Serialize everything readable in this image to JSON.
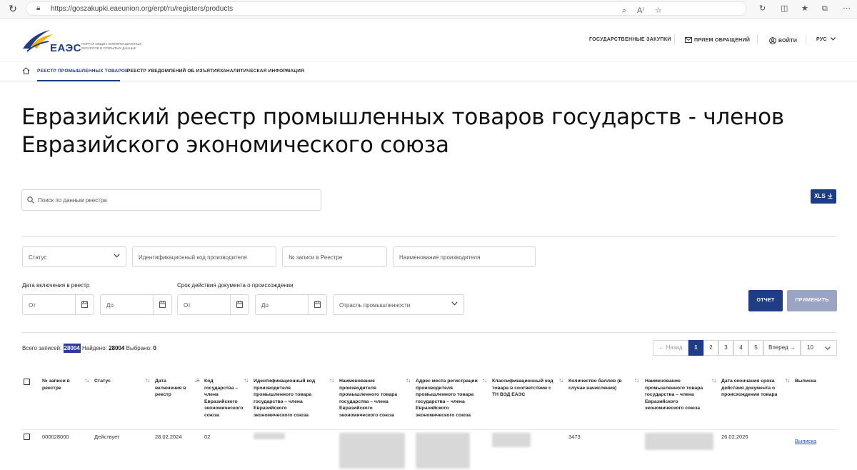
{
  "browser": {
    "url": "https://goszakupki.eaeunion.org/erpt/ru/registers/products"
  },
  "header": {
    "brand": "ЕАЭС",
    "tagline": "ПОРТАЛ ОБЩИХ ИНФОРМАЦИОННЫХ РЕСУРСОВ И ОТКРЫТЫХ ДАННЫХ",
    "nav_procurement": "ГОСУДАРСТВЕННЫЕ ЗАКУПКИ",
    "nav_appeals": "ПРИЕМ ОБРАЩЕНИЙ",
    "nav_login": "ВОЙТИ",
    "nav_lang": "РУС"
  },
  "subnav": {
    "tabs": [
      {
        "label": "РЕЕСТР ПРОМЫШЛЕННЫХ ТОВАРОВ"
      },
      {
        "label": "РЕЕСТР УВЕДОМЛЕНИЙ ОБ ИЗЪЯТИЯХ"
      },
      {
        "label": "АНАЛИТИЧЕСКАЯ ИНФОРМАЦИЯ"
      }
    ]
  },
  "page": {
    "title": "Евразийский реестр промышленных товаров государств - членов Евразийского экономического союза"
  },
  "search": {
    "placeholder": "Поиск по данным реестра",
    "xls_label": "XLS"
  },
  "filters": {
    "status": "Статус",
    "manufacturer_id": "Идентификационный код производителя",
    "record_no": "№ записи в Реестре",
    "manufacturer_name": "Наименование производителя",
    "date_included_label": "Дата включения в реестр",
    "doc_validity_label": "Срок действия документа о происхождении",
    "from": "От",
    "to": "До",
    "industry": "Отрасль промышленности",
    "report_button": "ОТЧЕТ",
    "apply_button": "ПРИМЕНИТЬ"
  },
  "summary": {
    "total_label": "Всего записей:",
    "total_value": "28004",
    "found_label": "Найдено:",
    "found_value": "28004",
    "selected_label": "Выбрано:",
    "selected_value": "0"
  },
  "pagination": {
    "prev": "Назад",
    "pages": [
      "1",
      "2",
      "3",
      "4",
      "5"
    ],
    "next": "Вперед",
    "page_size": "10"
  },
  "table": {
    "headers": [
      "№ записи в реестре",
      "Статус",
      "Дата включения в реестр",
      "Код государства – члена Евразийского экономического союза",
      "Идентификационный код производителя промышленного товара государства – члена Евразийского экономического союза",
      "Наименование производителя промышленного товара государства – члена Евразийского экономического союза",
      "Адрес места регистрации производителя промышленного товара государства – члена Евразийского экономического союза",
      "Классификационный код товара в соответствии с ТН ВЭД ЕАЭС",
      "Количество баллов (в случае начисления)",
      "Наименование промышленного товара государства – члена Евразийского экономического союза",
      "Дата окончания срока действия документа о происхождении товара",
      "Выписка"
    ],
    "rows": [
      {
        "record_no": "000028000",
        "status": "Действует",
        "date": "28.02.2024",
        "state_code": "02",
        "points": "3473",
        "end_date": "26.02.2026",
        "extract": "Выписка"
      }
    ]
  },
  "colors": {
    "accent": "#1f3d86",
    "apply_disabled": "#9aa4c4",
    "highlight": "#2e3a9a"
  }
}
